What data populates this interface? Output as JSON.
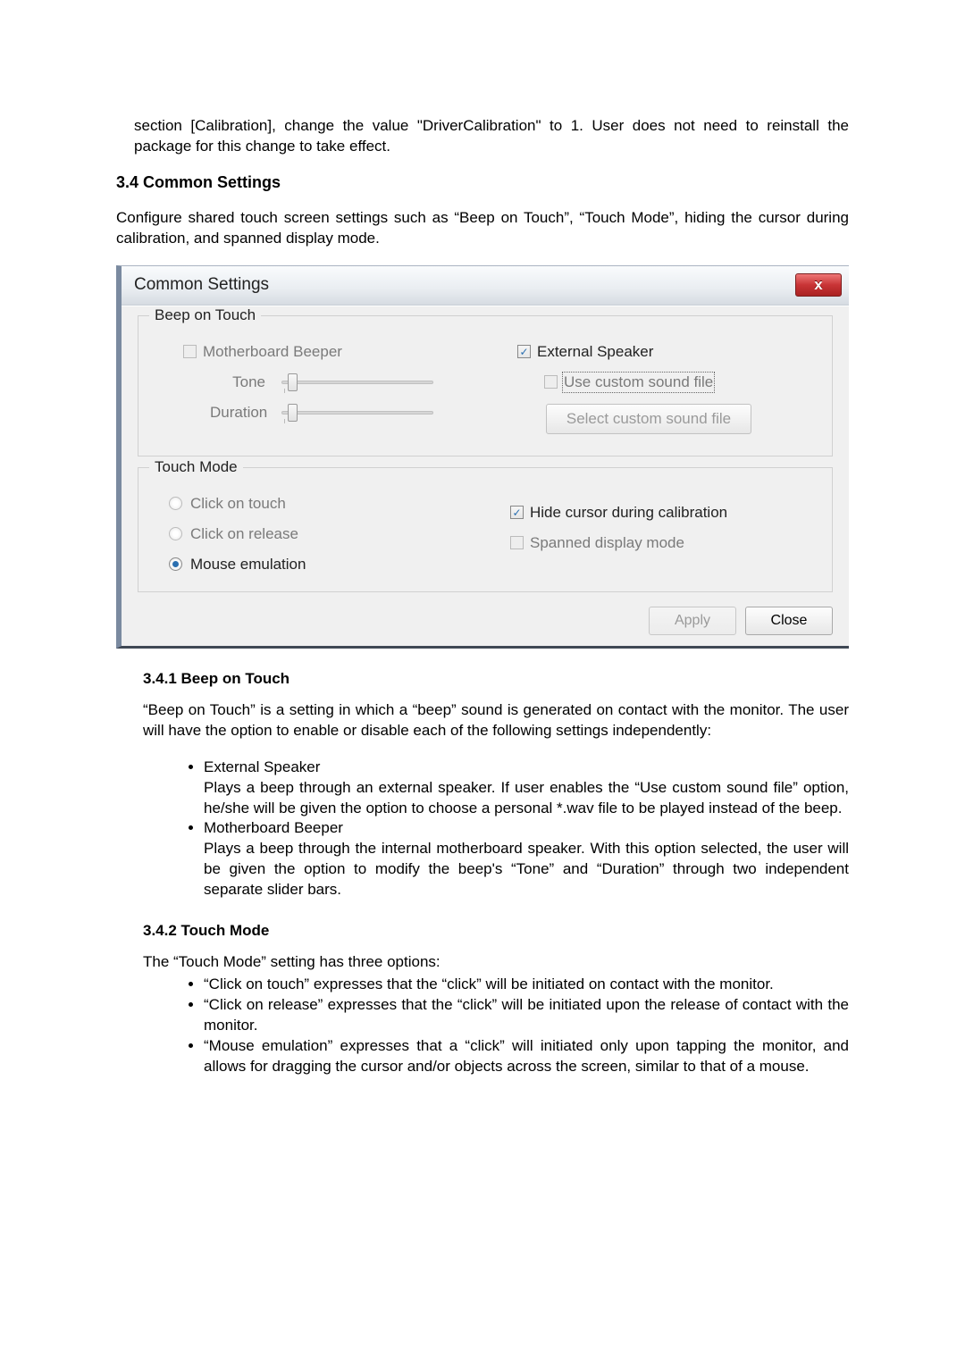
{
  "intro1": "section [Calibration], change the value \"DriverCalibration\" to 1. User does not need to reinstall the package for this change to take effect.",
  "h34": "3.4 Common Settings",
  "p34": "Configure shared touch screen settings such as “Beep on Touch”, “Touch Mode”, hiding the cursor during calibration, and spanned display mode.",
  "dialog": {
    "title": "Common Settings",
    "close": "x",
    "beep": {
      "legend": "Beep on Touch",
      "motherboard": "Motherboard Beeper",
      "tone": "Tone",
      "duration": "Duration",
      "external": "External Speaker",
      "customfile": "Use custom sound file",
      "selectbtn": "Select custom sound file"
    },
    "touch": {
      "legend": "Touch Mode",
      "click_touch": "Click on touch",
      "click_release": "Click on release",
      "mouse_em": "Mouse emulation",
      "hide_cursor": "Hide cursor during calibration",
      "spanned": "Spanned display mode"
    },
    "apply": "Apply",
    "close_btn": "Close"
  },
  "h341": "3.4.1 Beep on Touch",
  "p341": "“Beep on Touch” is a setting in which a “beep” sound is generated on contact with the monitor. The user will have the option to enable or disable each of the following settings independently:",
  "b341": {
    "a_t": "External Speaker",
    "a_d": "Plays a beep through an external speaker. If user enables the “Use custom sound file” option, he/she will be given the option to choose a personal *.wav file to be played instead of the beep.",
    "b_t": "Motherboard Beeper",
    "b_d": "Plays a beep through the internal motherboard speaker. With this option selected, the user will be given the option to modify the beep's “Tone” and “Duration” through two independent separate slider bars."
  },
  "h342": "3.4.2 Touch Mode",
  "p342": "The “Touch Mode” setting has three options:",
  "b342": {
    "a": "“Click on touch” expresses that the “click” will be initiated on contact with the monitor.",
    "b": "“Click on release” expresses that the “click” will be initiated upon the release of contact with the monitor.",
    "c": "“Mouse emulation” expresses that a “click” will initiated only upon tapping the monitor, and allows for dragging the cursor and/or objects across the screen, similar to that of a mouse."
  }
}
